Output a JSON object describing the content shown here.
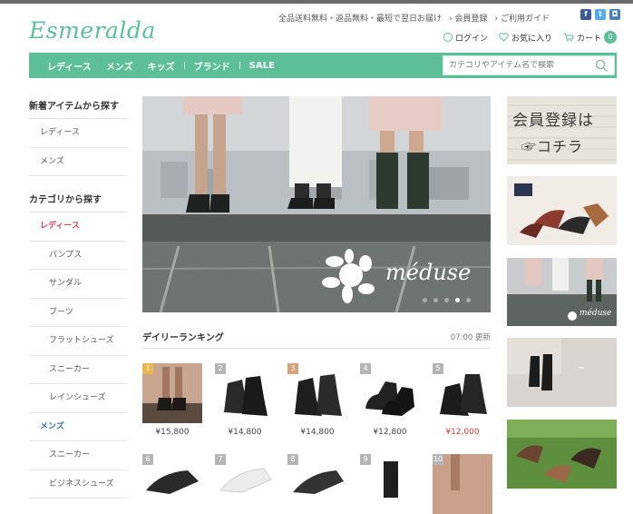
{
  "header": {
    "logo": "Esmeralda",
    "util_links": [
      "全品送料無料・返品無料・最短で翌日お届け",
      "会員登録",
      "ご利用ガイド"
    ],
    "login": "ログイン",
    "favorites": "お気に入り",
    "cart_label": "カート",
    "cart_count": "0"
  },
  "nav": {
    "items": [
      "レディース",
      "メンズ",
      "キッズ",
      "ブランド",
      "SALE"
    ],
    "search_placeholder": "カテゴリやアイテム名で検索"
  },
  "sidebar": {
    "section1_title": "新着アイテムから探す",
    "section1_items": [
      "レディース",
      "メンズ"
    ],
    "section2_title": "カテゴリから探す",
    "ladies_label": "レディース",
    "ladies_items": [
      "パンプス",
      "サンダル",
      "ブーツ",
      "フラットシューズ",
      "スニーカー",
      "レインシューズ"
    ],
    "mens_label": "メンズ",
    "mens_items": [
      "スニーカー",
      "ビジネスシューズ"
    ]
  },
  "hero": {
    "brand_text": "méduse"
  },
  "ranking": {
    "title": "デイリーランキング",
    "updated": "07:00 更新",
    "items": [
      {
        "rank": "1",
        "price": "¥15,800",
        "sale": false,
        "badge": "#e8b84a"
      },
      {
        "rank": "2",
        "price": "¥14,800",
        "sale": false,
        "badge": "#b5b5b5"
      },
      {
        "rank": "3",
        "price": "¥14,800",
        "sale": false,
        "badge": "#d9a07a"
      },
      {
        "rank": "4",
        "price": "¥12,800",
        "sale": false,
        "badge": "#b5b5b5"
      },
      {
        "rank": "5",
        "price": "¥12,000",
        "sale": true,
        "badge": "#b5b5b5"
      },
      {
        "rank": "6",
        "price": "",
        "sale": false,
        "badge": "#b5b5b5"
      },
      {
        "rank": "7",
        "price": "",
        "sale": false,
        "badge": "#b5b5b5"
      },
      {
        "rank": "8",
        "price": "",
        "sale": false,
        "badge": "#b5b5b5"
      },
      {
        "rank": "9",
        "price": "",
        "sale": false,
        "badge": "#b5b5b5"
      },
      {
        "rank": "10",
        "price": "",
        "sale": false,
        "badge": "#b5b5b5"
      }
    ]
  },
  "banners": {
    "member_text_line1": "会員登録は",
    "member_text_line2": "☞コチラ",
    "meduse_text": "méduse"
  },
  "colors": {
    "brand": "#5cbf97",
    "sale_red": "#d03a3a",
    "ladies_red": "#d04a5a",
    "mens_blue": "#3a6fb7"
  }
}
